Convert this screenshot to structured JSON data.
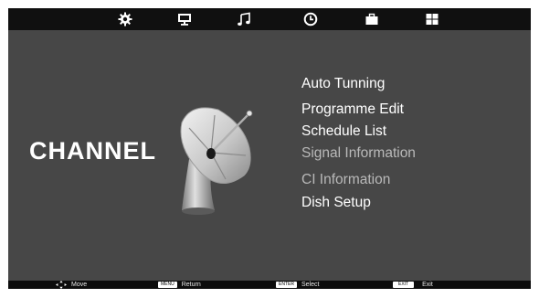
{
  "tabs": [
    {
      "name": "picture-tab",
      "icon": "gear-icon"
    },
    {
      "name": "display-tab",
      "icon": "monitor-icon"
    },
    {
      "name": "sound-tab",
      "icon": "music-note-icon"
    },
    {
      "name": "time-tab",
      "icon": "clock-icon"
    },
    {
      "name": "lock-tab",
      "icon": "briefcase-icon"
    },
    {
      "name": "setup-tab",
      "icon": "grid-icon"
    }
  ],
  "page": {
    "title": "CHANNEL",
    "illustration_icon": "satellite-dish-icon"
  },
  "menu": {
    "items": [
      {
        "label": "Auto Tunning",
        "enabled": true
      },
      {
        "label": "Programme Edit",
        "enabled": true
      },
      {
        "label": "Schedule List",
        "enabled": true
      },
      {
        "label": "Signal Information",
        "enabled": false
      },
      {
        "label": "CI Information",
        "enabled": false
      },
      {
        "label": "Dish Setup",
        "enabled": true
      }
    ]
  },
  "footer": {
    "move": {
      "icon": "four-way-arrows-icon",
      "label": "Move"
    },
    "return": {
      "key": "MENU",
      "label": "Return"
    },
    "select": {
      "key": "ENTER",
      "label": "Select"
    },
    "exit": {
      "key": "EXIT",
      "label": "Exit"
    }
  },
  "colors": {
    "background": "#474747",
    "bar": "#101010",
    "enabled_text": "#ffffff",
    "disabled_text": "#b9b9b9"
  }
}
